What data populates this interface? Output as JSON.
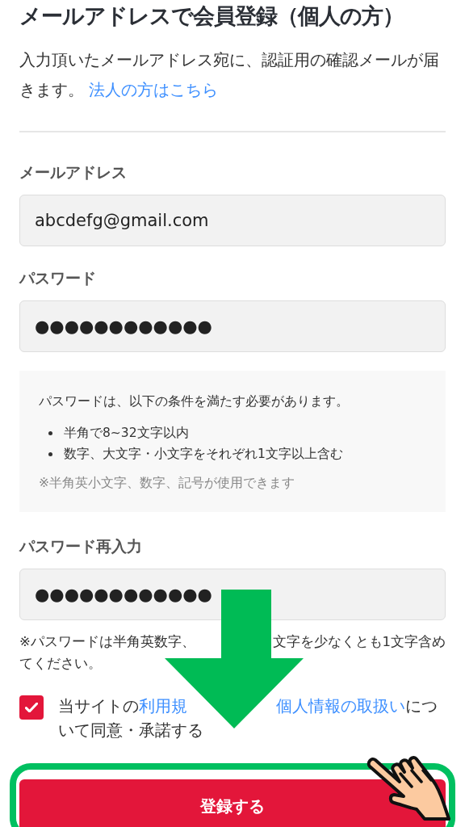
{
  "heading": "メールアドレスで会員登録（個人の方）",
  "intro": {
    "text": "入力頂いたメールアドレス宛に、認証用の確認メールが届きます。",
    "link": "法人の方はこちら"
  },
  "fields": [
    {
      "label": "メールアドレス",
      "value": "abcdefg@gmail.com"
    },
    {
      "label": "パスワード",
      "value": "●●●●●●●●●●●●"
    }
  ],
  "requirements": {
    "lead": "パスワードは、以下の条件を満たす必要があります。",
    "items": [
      "半角で8~32文字以内",
      "数字、大文字・小文字をそれぞれ1文字以上含む"
    ],
    "note": "※半角英小文字、数字、記号が使用できます"
  },
  "confirm_field": {
    "label": "パスワード再入力",
    "value": "●●●●●●●●●●●●"
  },
  "password_note": {
    "lines": [
      [
        {
          "kind": "text",
          "text": "※パスワードは半角英数字、"
        },
        {
          "kind": "covered"
        },
        {
          "kind": "text",
          "text": "文字を少なくとも1文字含め"
        }
      ],
      [
        {
          "kind": "text",
          "text": "てください。"
        }
      ]
    ]
  },
  "agreement": {
    "checked": true,
    "lines": [
      [
        {
          "kind": "text",
          "text": "当サイトの"
        },
        {
          "kind": "link",
          "text": "利用規"
        },
        {
          "kind": "covered"
        },
        {
          "kind": "link",
          "text": "個人情報の取扱い"
        },
        {
          "kind": "text",
          "text": "につ"
        }
      ],
      [
        {
          "kind": "text",
          "text": "いて同意・承諾する"
        }
      ]
    ]
  },
  "submit": "登録する"
}
